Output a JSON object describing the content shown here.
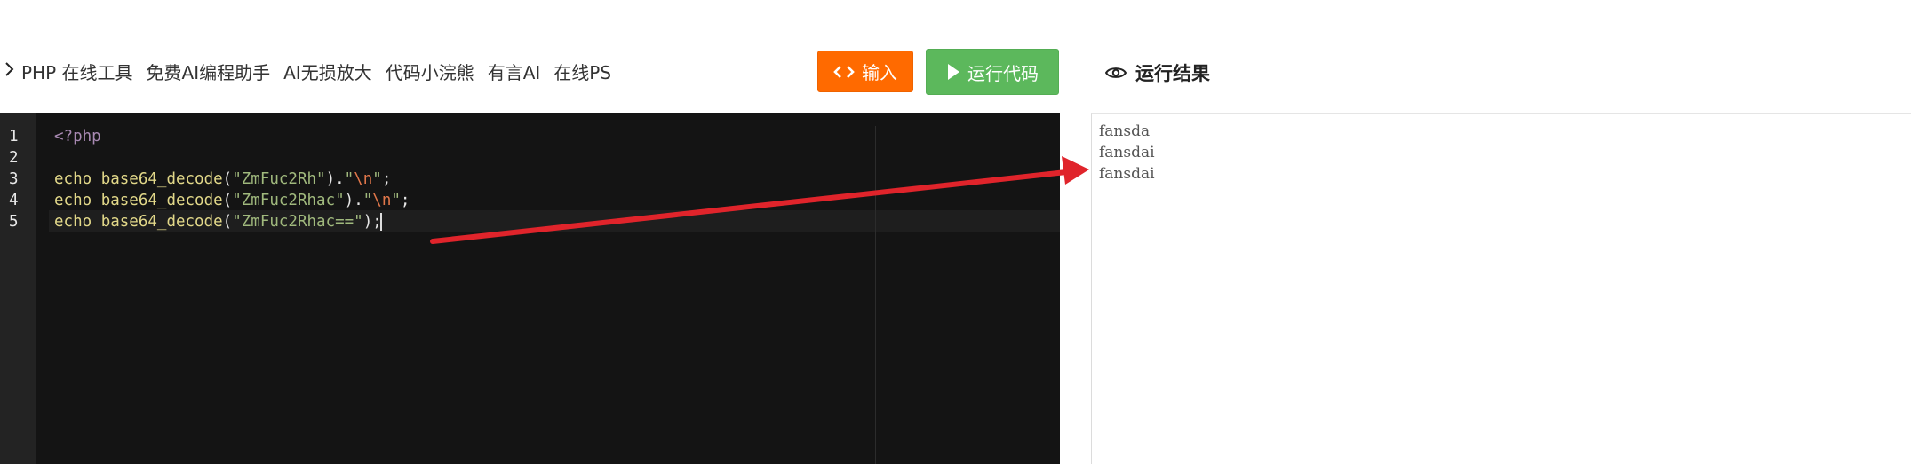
{
  "nav": {
    "links": [
      "PHP 在线工具",
      "免费AI编程助手",
      "AI无损放大",
      "代码小浣熊",
      "有言AI",
      "在线PS"
    ]
  },
  "toolbar": {
    "input_label": "输入",
    "run_label": "运行代码"
  },
  "result": {
    "title": "运行结果",
    "lines": [
      "fansda",
      "fansdai",
      "fansdai"
    ]
  },
  "editor": {
    "line_numbers": [
      "1",
      "2",
      "3",
      "4",
      "5"
    ],
    "active_line": 5,
    "code": {
      "line1": "<?php",
      "line3": {
        "echo": "echo",
        "fn": "base64_decode",
        "open": "(",
        "arg": "\"ZmFuc2Rh\"",
        "close": ").",
        "nl_q1": "\"",
        "nl_esc": "\\n",
        "nl_q2": "\"",
        "end": ";"
      },
      "line4": {
        "echo": "echo",
        "fn": "base64_decode",
        "open": "(",
        "arg": "\"ZmFuc2Rhac\"",
        "close": ").",
        "nl_q1": "\"",
        "nl_esc": "\\n",
        "nl_q2": "\"",
        "end": ";"
      },
      "line5": {
        "echo": "echo",
        "fn": "base64_decode",
        "open": "(",
        "arg": "\"ZmFuc2Rhac==\"",
        "end": ");"
      }
    }
  },
  "colors": {
    "input_button": "#ff6a00",
    "run_button": "#5cb85c",
    "editor_bg": "#141414",
    "gutter_bg": "#232323",
    "annotation_arrow": "#e0242b"
  },
  "icons": {
    "chevron": "chevron-right-icon",
    "input": "code-brackets-icon",
    "run": "play-icon",
    "result": "eye-icon"
  }
}
